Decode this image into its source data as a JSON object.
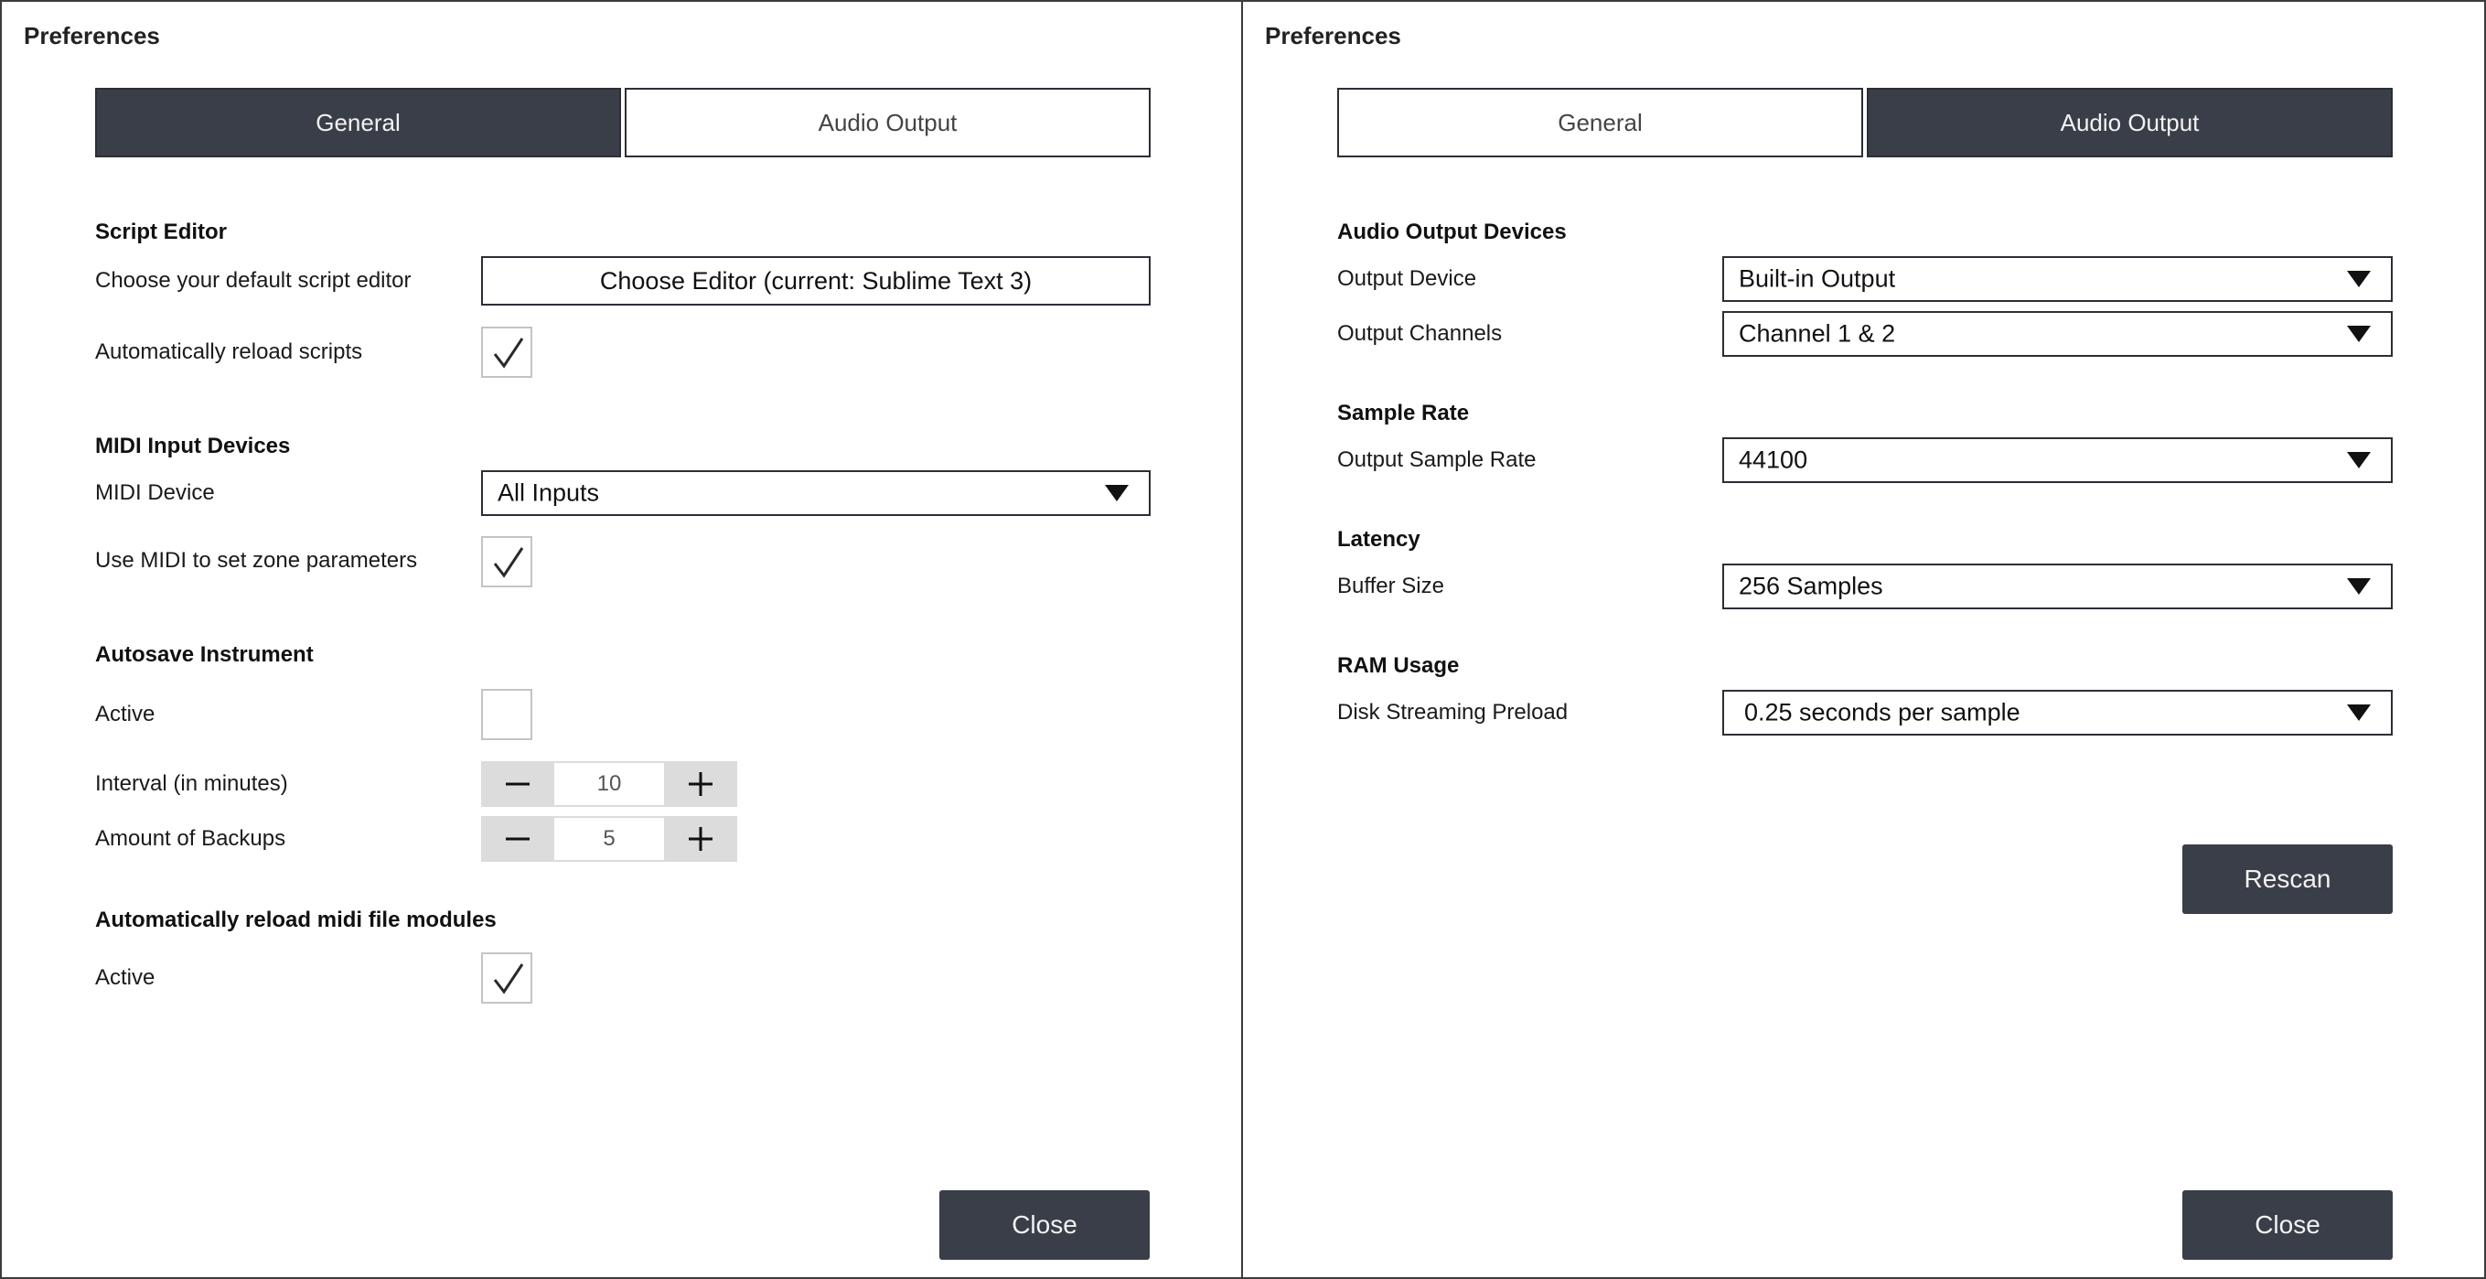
{
  "left": {
    "window_title": "Preferences",
    "tabs": [
      {
        "label": "General",
        "active": true
      },
      {
        "label": "Audio Output",
        "active": false
      }
    ],
    "script_editor": {
      "heading": "Script Editor",
      "default_editor_label": "Choose your default script editor",
      "editor_button": "Choose Editor (current: Sublime Text 3)",
      "auto_reload_label": "Automatically reload scripts",
      "auto_reload_checked": true
    },
    "midi": {
      "heading": "MIDI Input Devices",
      "device_label": "MIDI Device",
      "device_value": "All Inputs",
      "zone_label": "Use MIDI to set zone parameters",
      "zone_checked": true
    },
    "autosave": {
      "heading": "Autosave Instrument",
      "active_label": "Active",
      "active_checked": false,
      "interval_label": "Interval (in minutes)",
      "interval_value": "10",
      "backups_label": "Amount of Backups",
      "backups_value": "5"
    },
    "midi_reload": {
      "heading": "Automatically reload midi file modules",
      "active_label": "Active",
      "active_checked": true
    },
    "close_label": "Close"
  },
  "right": {
    "window_title": "Preferences",
    "tabs": [
      {
        "label": "General",
        "active": false
      },
      {
        "label": "Audio Output",
        "active": true
      }
    ],
    "audio_devices": {
      "heading": "Audio Output Devices",
      "output_device_label": "Output Device",
      "output_device_value": "Built-in Output",
      "output_channels_label": "Output Channels",
      "output_channels_value": "Channel 1 & 2"
    },
    "sample_rate": {
      "heading": "Sample Rate",
      "label": "Output Sample Rate",
      "value": "44100"
    },
    "latency": {
      "heading": "Latency",
      "label": "Buffer Size",
      "value": "256 Samples"
    },
    "ram": {
      "heading": "RAM Usage",
      "label": "Disk Streaming Preload",
      "value": "0.25 seconds per sample"
    },
    "rescan_label": "Rescan",
    "close_label": "Close"
  },
  "colors": {
    "accent_dark": "#3a3e48",
    "border": "#2b2e35",
    "stepper_bg": "#dcdcdc",
    "checkbox_border": "#c4c4c4"
  }
}
